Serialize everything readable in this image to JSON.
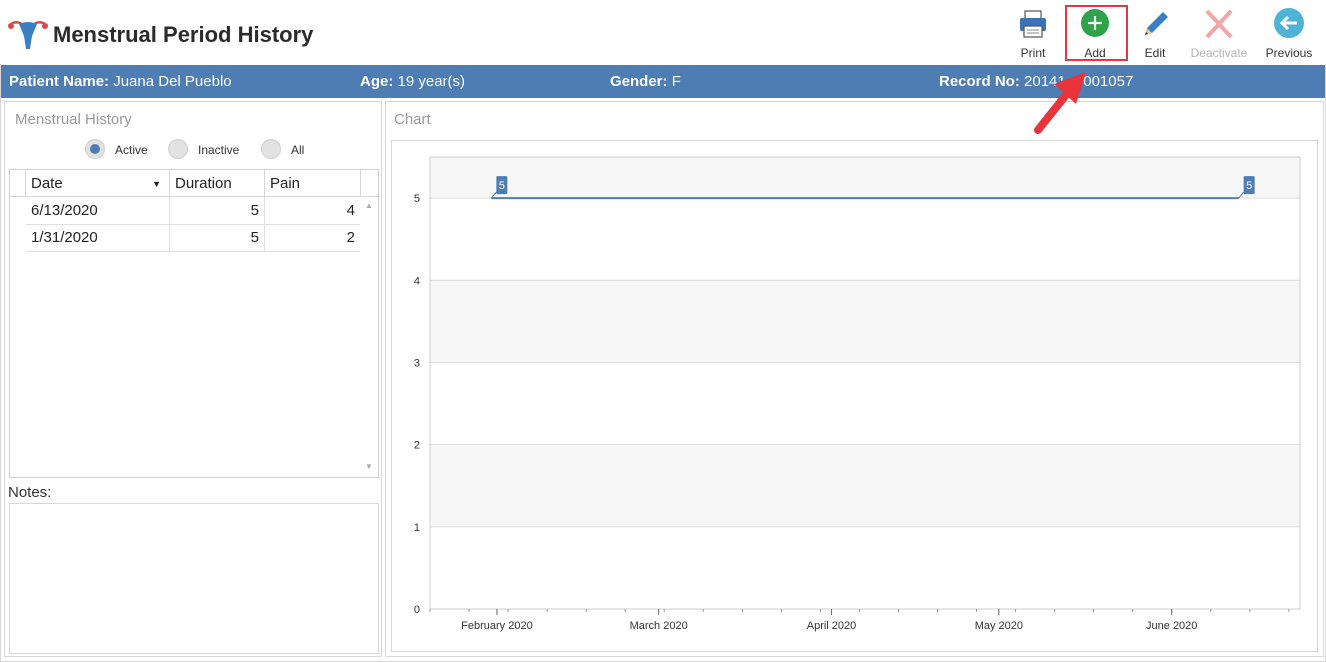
{
  "header": {
    "title": "Menstrual Period History",
    "toolbar": [
      {
        "id": "print",
        "label": "Print",
        "icon": "printer-icon",
        "disabled": false
      },
      {
        "id": "add",
        "label": "Add",
        "icon": "plus-circle-icon",
        "disabled": false
      },
      {
        "id": "edit",
        "label": "Edit",
        "icon": "pencil-icon",
        "disabled": false
      },
      {
        "id": "deactivate",
        "label": "Deactivate",
        "icon": "x-icon",
        "disabled": true
      },
      {
        "id": "previous",
        "label": "Previous",
        "icon": "arrow-left-circle-icon",
        "disabled": false
      }
    ]
  },
  "patient": {
    "name_label": "Patient Name:",
    "name": "Juana Del Pueblo",
    "age_label": "Age:",
    "age": "19 year(s)",
    "gender_label": "Gender:",
    "gender": "F",
    "record_label": "Record No:",
    "record_no": "20141 -0001057"
  },
  "history": {
    "title": "Menstrual History",
    "filters": [
      {
        "label": "Active",
        "checked": true
      },
      {
        "label": "Inactive",
        "checked": false
      },
      {
        "label": "All",
        "checked": false
      }
    ],
    "columns": [
      "Date",
      "Duration",
      "Pain"
    ],
    "rows": [
      {
        "date": "6/13/2020",
        "duration": "5",
        "pain": "4"
      },
      {
        "date": "1/31/2020",
        "duration": "5",
        "pain": "2"
      }
    ]
  },
  "notes": {
    "label": "Notes:"
  },
  "chart": {
    "title": "Chart"
  },
  "chart_data": {
    "type": "line",
    "x_ticks": [
      "February 2020",
      "March 2020",
      "April 2020",
      "May 2020",
      "June 2020"
    ],
    "y_ticks": [
      0,
      1,
      2,
      3,
      4,
      5
    ],
    "ylim": [
      0,
      5.5
    ],
    "series": [
      {
        "points": [
          {
            "x": "2020-01-31",
            "y": 5
          },
          {
            "x": "2020-06-13",
            "y": 5
          }
        ]
      }
    ],
    "data_labels": [
      "5",
      "5"
    ],
    "grid": true,
    "color": "#4d7db3"
  },
  "colors": {
    "accent": "#4d7db3",
    "add_green": "#2ea34a",
    "highlight_red": "#e0393e"
  }
}
